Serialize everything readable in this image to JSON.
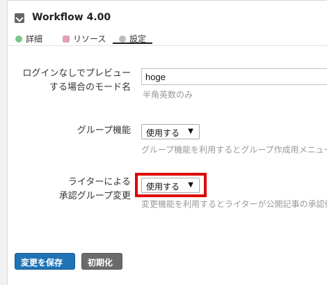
{
  "header": {
    "title": "Workflow 4.00",
    "icon": "workflow-icon"
  },
  "tabs": [
    {
      "label": "詳細",
      "icon": "details-icon"
    },
    {
      "label": "リソース",
      "icon": "resources-icon"
    },
    {
      "label": "設定",
      "icon": "settings-icon",
      "active": true
    }
  ],
  "form": {
    "preview_mode": {
      "label_line1": "ログインなしでプレビュー",
      "label_line2": "する場合のモード名",
      "value": "hoge",
      "hint": "半角英数のみ"
    },
    "group_feature": {
      "label": "グループ機能",
      "selected": "使用する",
      "hint": "グループ機能を利用するとグループ作成用メニュー"
    },
    "writer_approval": {
      "label_line1": "ライターによる",
      "label_line2": "承認グループ変更",
      "selected": "使用する",
      "hint": "変更機能を利用するとライターが公開記事の承認依"
    }
  },
  "buttons": {
    "save": "変更を保存",
    "reset": "初期化"
  },
  "colors": {
    "highlight": "#e00000",
    "primary": "#1f73b7",
    "secondary": "#6b6b6b"
  }
}
